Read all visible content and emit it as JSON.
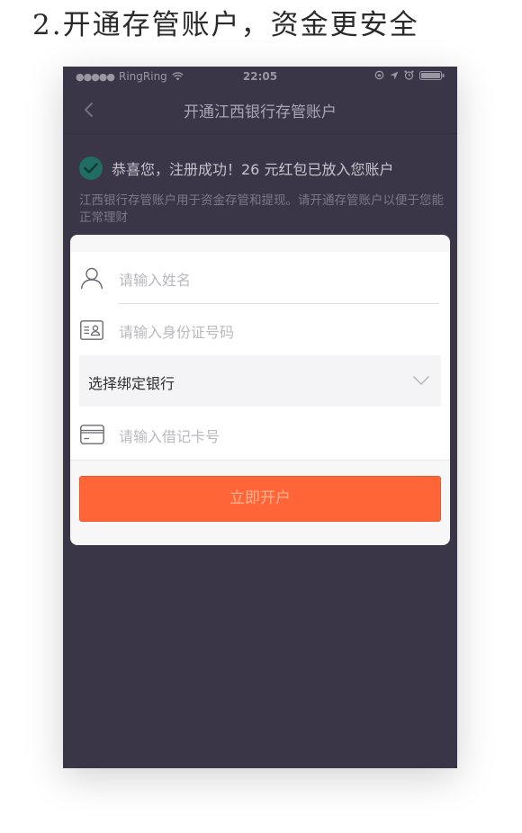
{
  "caption": "2.开通存管账户，资金更安全",
  "status_bar": {
    "signal": "●●●●●",
    "carrier": "RingRing",
    "time": "22:05"
  },
  "nav": {
    "title": "开通江西银行存管账户"
  },
  "notice": {
    "success_text": "恭喜您，注册成功！26 元红包已放入您账户",
    "description": "江西银行存管账户用于资金存管和提现。请开通存管账户以便于您能正常理财"
  },
  "form": {
    "name_placeholder": "请输入姓名",
    "id_placeholder": "请输入身份证号码",
    "bank_select_label": "选择绑定银行",
    "card_placeholder": "请输入借记卡号",
    "submit_label": "立即开户"
  },
  "colors": {
    "primary": "#ff6536",
    "overlay": "#3a3547",
    "success": "#216c63"
  },
  "icons": {
    "back": "chevron-left-icon",
    "success": "check-circle-icon",
    "name": "user-icon",
    "id": "id-card-icon",
    "bank": "chevron-down-icon",
    "card": "bank-card-icon"
  }
}
